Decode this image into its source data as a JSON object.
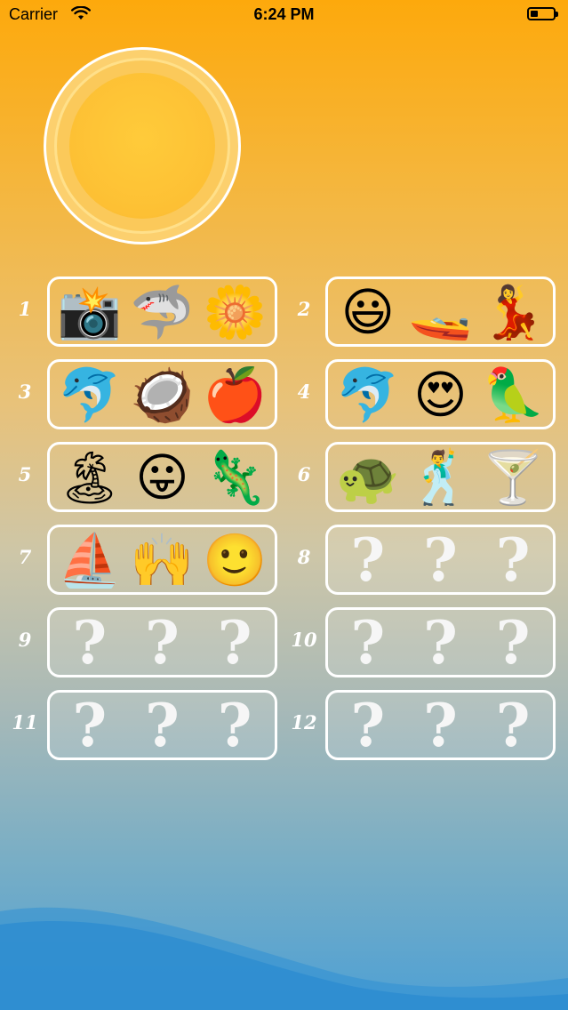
{
  "status": {
    "carrier": "Carrier",
    "time": "6:24 PM"
  },
  "levels": [
    {
      "num": "1",
      "cells": [
        "📸",
        "🦈",
        "🌼"
      ]
    },
    {
      "num": "2",
      "cells": [
        "😃",
        "🚤",
        "💃"
      ]
    },
    {
      "num": "3",
      "cells": [
        "🐬",
        "🥥",
        "🍎"
      ]
    },
    {
      "num": "4",
      "cells": [
        "🐬",
        "😍",
        "🦜"
      ]
    },
    {
      "num": "5",
      "cells": [
        "🏝",
        "😛",
        "🦎"
      ]
    },
    {
      "num": "6",
      "cells": [
        "🐢",
        "🕺",
        "🍸"
      ]
    },
    {
      "num": "7",
      "cells": [
        "⛵",
        "🙌",
        "🙂"
      ]
    },
    {
      "num": "8",
      "cells": [
        "?",
        "?",
        "?"
      ]
    },
    {
      "num": "9",
      "cells": [
        "?",
        "?",
        "?"
      ]
    },
    {
      "num": "10",
      "cells": [
        "?",
        "?",
        "?"
      ]
    },
    {
      "num": "11",
      "cells": [
        "?",
        "?",
        "?"
      ]
    },
    {
      "num": "12",
      "cells": [
        "?",
        "?",
        "?"
      ]
    }
  ],
  "icons": {
    "sun": "sun-icon",
    "wifi": "wifi-icon",
    "battery": "battery-icon"
  }
}
